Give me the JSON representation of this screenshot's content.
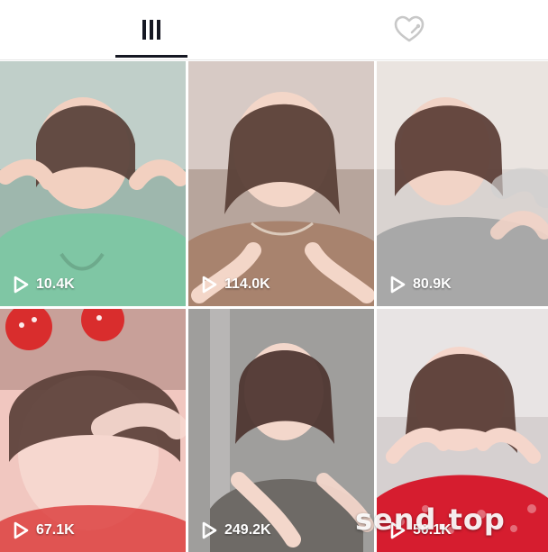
{
  "tabs": {
    "videos_icon": "grid-bars-icon",
    "liked_icon": "heart-lock-icon",
    "active_color": "#161823",
    "inactive_color": "#c8c8c8"
  },
  "videos": [
    {
      "views": "10.4K",
      "bg": "#9eb7ad",
      "accent": "#7fc6a4"
    },
    {
      "views": "114.0K",
      "bg": "#b7a59c",
      "accent": "#a8836e"
    },
    {
      "views": "80.9K",
      "bg": "#d9d3d0",
      "accent": "#a8a8a8"
    },
    {
      "views": "67.1K",
      "bg": "#f1c7c0",
      "accent": "#d92d2d"
    },
    {
      "views": "249.2K",
      "bg": "#a8a7a6",
      "accent": "#6e6a66"
    },
    {
      "views": "50.1K",
      "bg": "#d6d0d0",
      "accent": "#d61d2f"
    }
  ],
  "watermark": "send.top"
}
